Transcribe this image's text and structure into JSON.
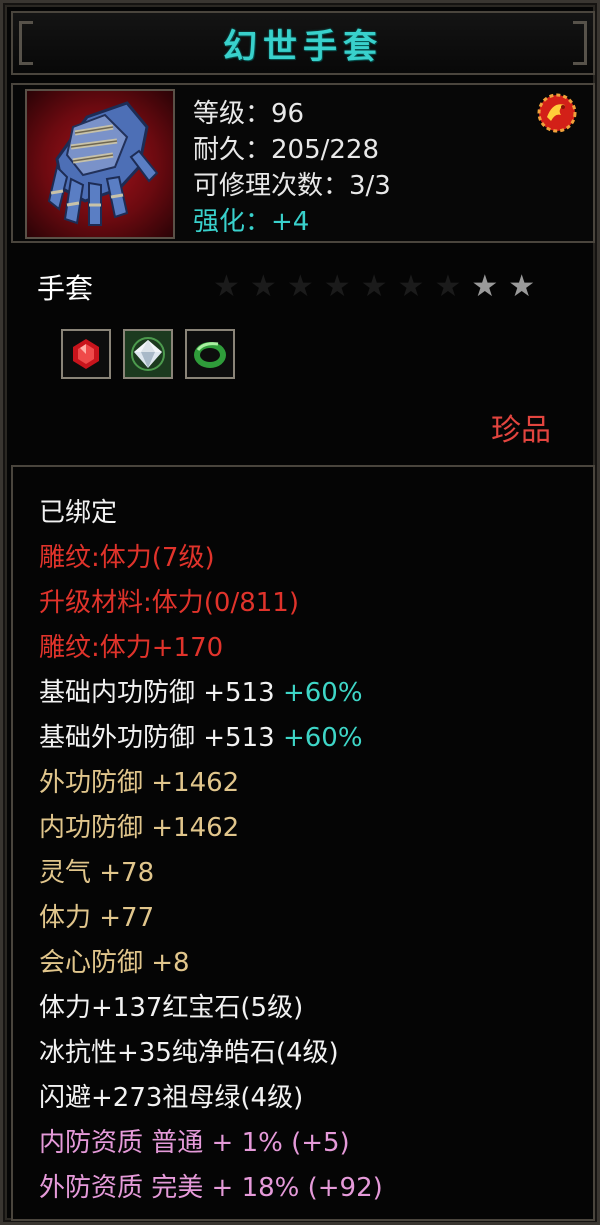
{
  "title": "幻世手套",
  "header": {
    "icon": "gauntlet-icon",
    "level": "等级：96",
    "durability": "耐久：205/228",
    "repair": "可修理次数：3/3",
    "enhance": "强化：+4",
    "badge_icon": "dragon-emblem-icon"
  },
  "type_label": "手套",
  "stars": {
    "total": 9,
    "lit": 2
  },
  "gems": [
    "ruby-icon",
    "diamond-icon",
    "emerald-icon"
  ],
  "rarity": "珍品",
  "attributes": {
    "bound": "已绑定",
    "engrave1": "雕纹:体力(7级)",
    "upgrade_material": "升级材料:体力(0/811)",
    "engrave2": "雕纹:体力+170",
    "base_inner_def": "基础内功防御 +513",
    "base_inner_def_bonus": "+60%",
    "base_outer_def": "基础外功防御 +513",
    "base_outer_def_bonus": "+60%",
    "outer_def": "外功防御 +1462",
    "inner_def": "内功防御 +1462",
    "spirit": "灵气 +78",
    "stamina": "体力 +77",
    "crit_def": "会心防御 +8",
    "gem1": "体力+137红宝石(5级)",
    "gem2": "冰抗性+35纯净皓石(4级)",
    "gem3": "闪避+273祖母绿(4级)",
    "inner_quality": "内防资质 普通 + 1% (+5)",
    "outer_quality": "外防资质 完美 + 18% (+92)"
  },
  "colors": {
    "title": "#39d1cc",
    "rarity": "#e3453f",
    "engrave": "#e0332b",
    "base_stat": "#e1c68c",
    "quality": "#e59ad9",
    "bonus": "#3ed6c7"
  }
}
